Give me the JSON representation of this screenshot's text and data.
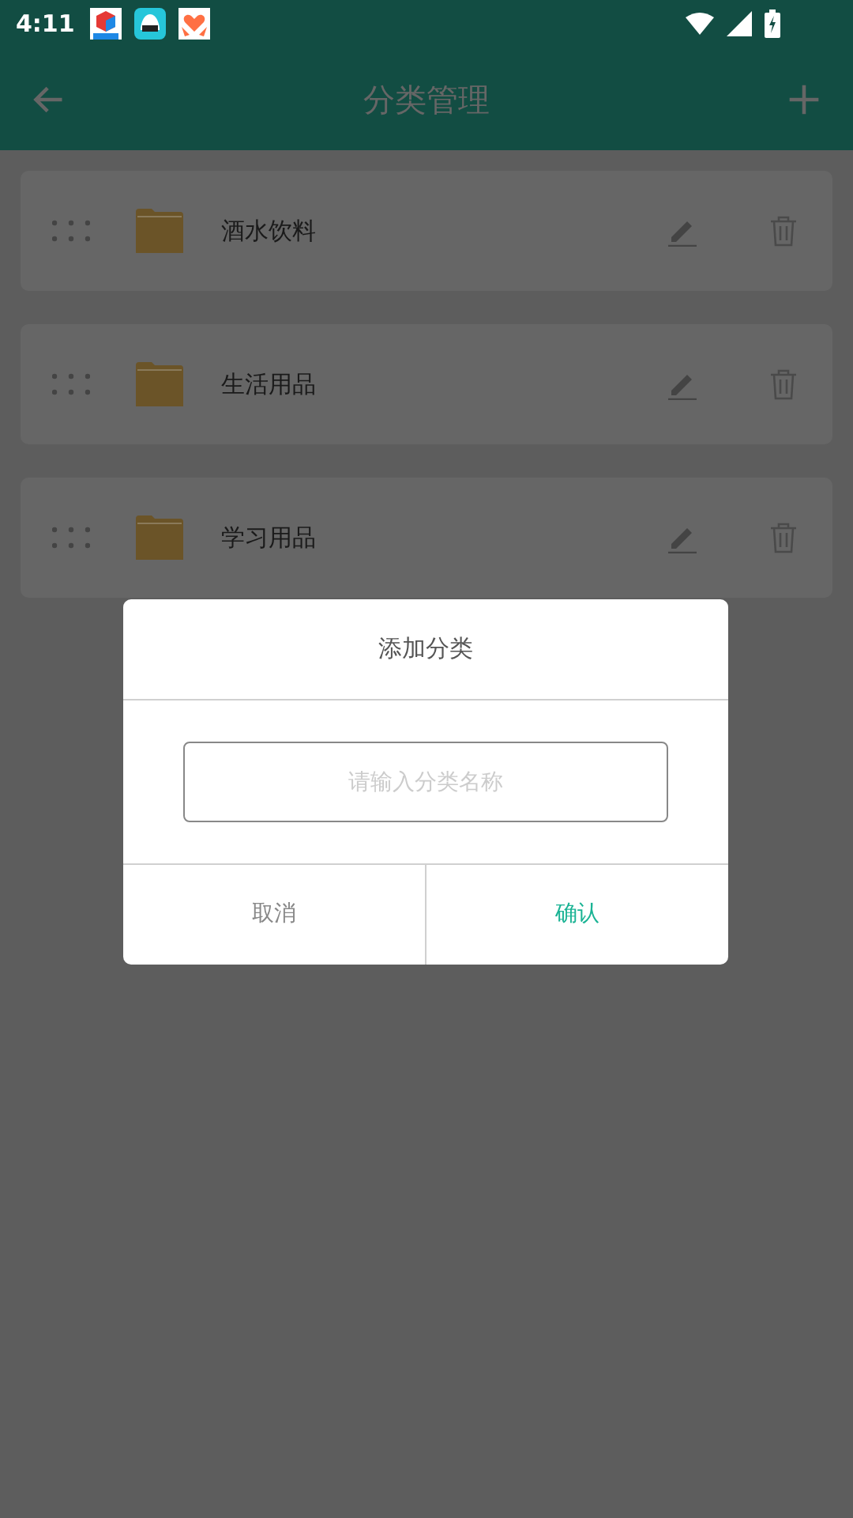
{
  "status_bar": {
    "time": "4:11"
  },
  "header": {
    "title": "分类管理"
  },
  "categories": [
    {
      "name": "酒水饮料"
    },
    {
      "name": "生活用品"
    },
    {
      "name": "学习用品"
    }
  ],
  "dialog": {
    "title": "添加分类",
    "input": {
      "placeholder": "请输入分类名称"
    },
    "buttons": [
      {
        "label": "取消",
        "kind": "cancel"
      },
      {
        "label": "确认",
        "kind": "confirm"
      }
    ]
  }
}
